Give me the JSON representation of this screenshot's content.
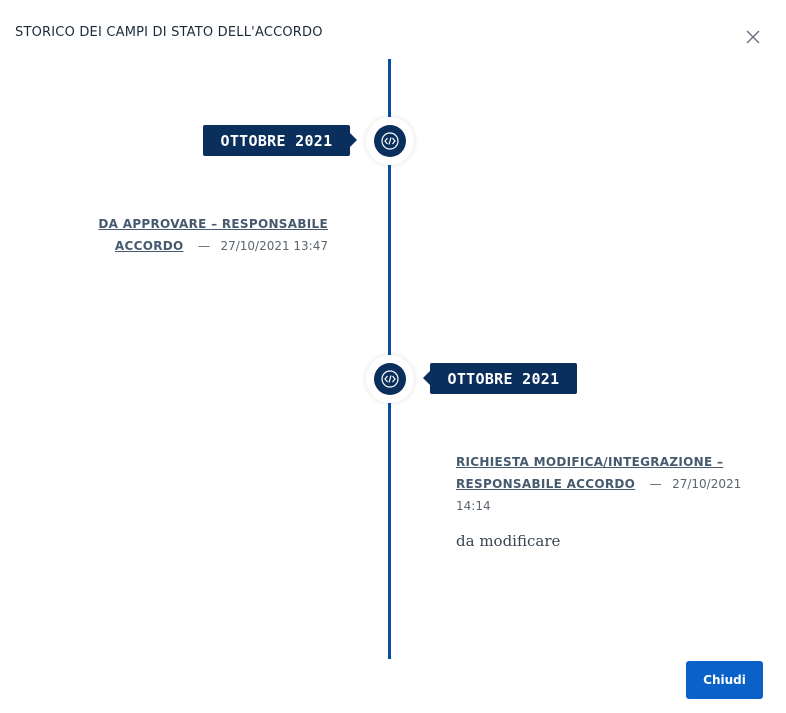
{
  "dialog": {
    "title": "STORICO DEI CAMPI DI STATO DELL'ACCORDO",
    "close_icon": "close-icon"
  },
  "timeline": {
    "line_color": "#0a4ea3",
    "node_color": "#0b2f5c",
    "node_icon": "code-icon",
    "entries": [
      {
        "date_label": "OTTOBRE 2021",
        "title_line1": "DA APPROVARE – RESPONSABILE",
        "title_line2": "ACCORDO",
        "separator": "—",
        "timestamp": "27/10/2021 13:47",
        "description": ""
      },
      {
        "date_label": "OTTOBRE 2021",
        "title_line1": "RICHIESTA MODIFICA/INTEGRAZIONE –",
        "title_line2": "RESPONSABILE ACCORDO",
        "separator": "—",
        "timestamp_part1": "27/10/2021",
        "timestamp_part2": "14:14",
        "description": "da modificare"
      }
    ]
  },
  "footer": {
    "close_button_label": "Chiudi",
    "accent_color": "#0a62c9"
  }
}
